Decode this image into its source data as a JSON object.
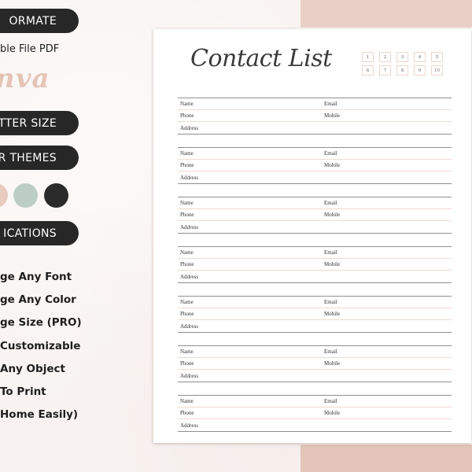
{
  "left_panel": {
    "format_pill": "ORMATE",
    "file_text": "ble File PDF",
    "canva_text": "nva",
    "size_pill": "TTER SIZE",
    "themes_pill": "R THEMES",
    "theme_swatches": [
      {
        "name": "blush",
        "color": "#e8cabe"
      },
      {
        "name": "sage",
        "color": "#bccdc4"
      },
      {
        "name": "charcoal",
        "color": "#2b2b2b"
      }
    ],
    "modifications_pill": "ICATIONS",
    "features": [
      "ge Any Font",
      "ge Any Color",
      "ge Size (PRO)",
      "Customizable",
      "Any Object",
      "To Print",
      "Home Easily)"
    ]
  },
  "document": {
    "title": "Contact List",
    "pages": [
      "1",
      "2",
      "3",
      "4",
      "5",
      "6",
      "7",
      "8",
      "9",
      "10"
    ],
    "contacts": [
      {
        "rows": [
          [
            "Name",
            "Email"
          ],
          [
            "Phone",
            "Mobile"
          ],
          [
            "Address",
            ""
          ]
        ]
      },
      {
        "rows": [
          [
            "Name",
            "Email"
          ],
          [
            "Phone",
            "Mobile"
          ],
          [
            "Address",
            ""
          ]
        ]
      },
      {
        "rows": [
          [
            "Name",
            "Email"
          ],
          [
            "Phone",
            "Mobile"
          ],
          [
            "Address",
            ""
          ]
        ]
      },
      {
        "rows": [
          [
            "Name",
            "Email"
          ],
          [
            "Phone",
            "Mobile"
          ],
          [
            "Address",
            ""
          ]
        ]
      },
      {
        "rows": [
          [
            "Name",
            "Email"
          ],
          [
            "Phone",
            "Mobile"
          ],
          [
            "Address",
            ""
          ]
        ]
      },
      {
        "rows": [
          [
            "Name",
            "Email"
          ],
          [
            "Phone",
            "Mobile"
          ],
          [
            "Address",
            ""
          ]
        ]
      },
      {
        "rows": [
          [
            "Name",
            "Email"
          ],
          [
            "Phone",
            "Mobile"
          ],
          [
            "Address",
            ""
          ]
        ]
      }
    ]
  },
  "colors": {
    "accent_pink": "#e9d0c6",
    "pill_dark": "#272727",
    "canva_pink": "#e5c4b6"
  }
}
